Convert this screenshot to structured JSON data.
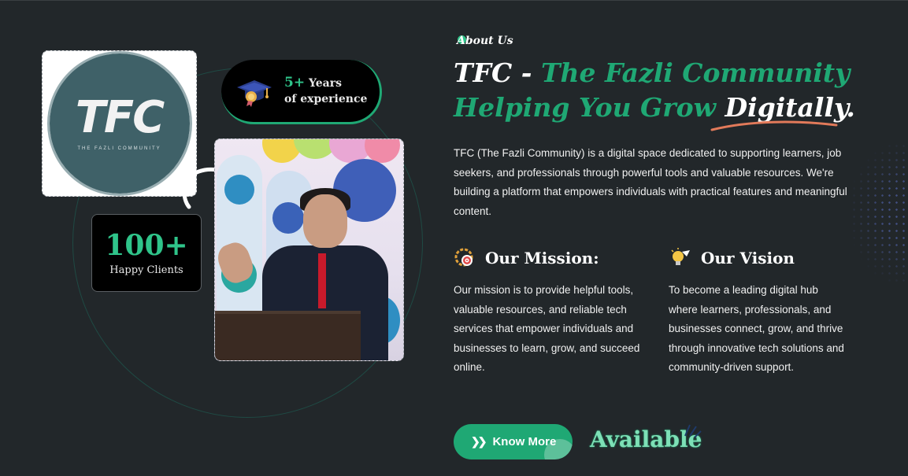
{
  "about_tag": "About Us",
  "headline": {
    "line1_white": "TFC - ",
    "line1_green": "The Fazli Community",
    "line2_green": "Helping You Grow ",
    "line2_white": "Digitally",
    "line2_dot": "."
  },
  "intro": "TFC (The Fazli Community) is a digital space dedicated to supporting learners, job seekers, and professionals through powerful tools and valuable resources. We're building a platform that empowers individuals with practical features and meaningful content.",
  "mission": {
    "title": "Our Mission:",
    "icon": "target-gear-icon",
    "text": "Our mission is to provide helpful tools, valuable resources, and reliable tech services that empower individuals and businesses to learn, grow, and succeed online."
  },
  "vision": {
    "title": "Our Vision",
    "icon": "lightbulb-icon",
    "text": "To become a leading digital hub where learners, professionals, and businesses connect, grow, and thrive through innovative tech solutions and community-driven support."
  },
  "logo": {
    "text": "TFC",
    "subtext": "THE FAZLI COMMUNITY"
  },
  "experience": {
    "number": "5+",
    "label1": "Years",
    "label2": "of experience",
    "icon": "graduation-cap-icon"
  },
  "clients": {
    "number": "100+",
    "label": "Happy Clients"
  },
  "buttons": {
    "know_more": "Know More"
  },
  "available_label": "Available",
  "colors": {
    "background": "#22272a",
    "accent": "#1fa874",
    "accent_light": "#2fc48a",
    "card_dark": "#000000"
  }
}
